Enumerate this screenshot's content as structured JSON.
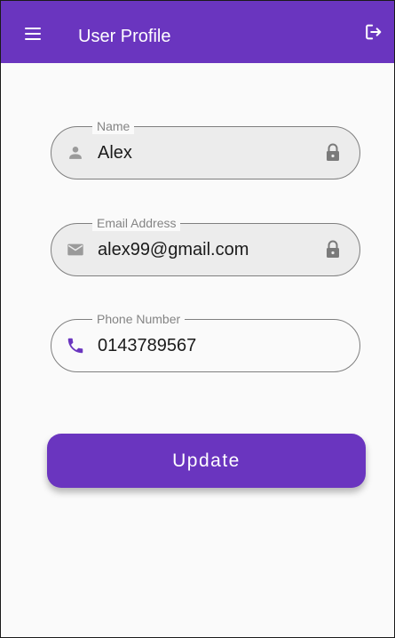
{
  "appbar": {
    "title": "User Profile",
    "menu_icon": "hamburger-menu-icon",
    "logout_icon": "logout-icon",
    "color": "#6a35bf"
  },
  "form": {
    "name": {
      "label": "Name",
      "value": "Alex",
      "icon": "person-icon",
      "locked": true
    },
    "email": {
      "label": "Email Address",
      "value": "alex99@gmail.com",
      "icon": "mail-icon",
      "locked": true
    },
    "phone": {
      "label": "Phone Number",
      "value": "0143789567",
      "icon": "phone-icon",
      "icon_color": "#6a35bf",
      "locked": false
    }
  },
  "update_button": {
    "label": "Update"
  }
}
